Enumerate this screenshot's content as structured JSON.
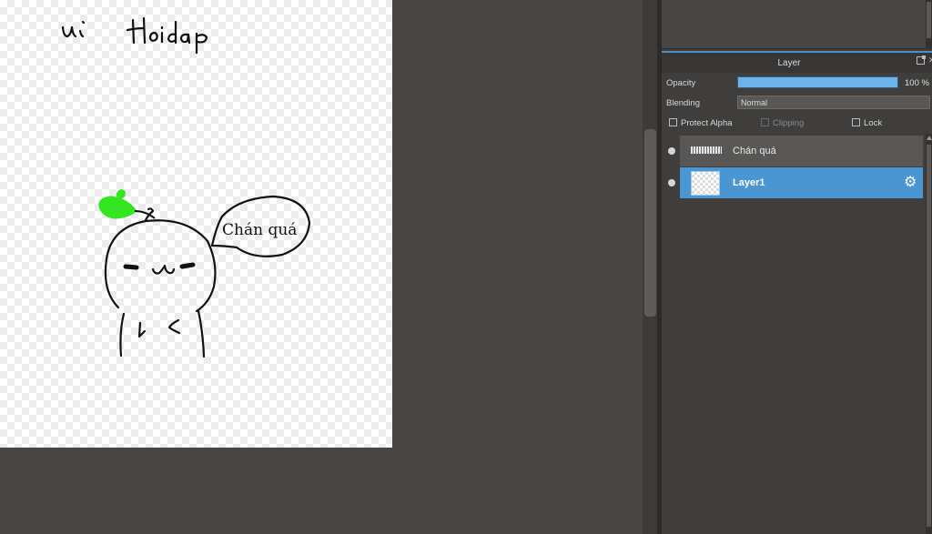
{
  "canvas": {
    "drawing": {
      "handwritten_title": "ui Hoidap",
      "speech_bubble_text": "Chán quá"
    }
  },
  "layer_panel": {
    "title": "Layer",
    "opacity": {
      "label": "Opacity",
      "value_text": "100 %",
      "value": 1.0
    },
    "blending": {
      "label": "Blending",
      "value": "Normal"
    },
    "options": {
      "protect_alpha": {
        "label": "Protect Alpha",
        "checked": false
      },
      "clipping": {
        "label": "Clipping",
        "checked": false,
        "disabled": true
      },
      "lock": {
        "label": "Lock",
        "checked": false
      }
    },
    "layers": [
      {
        "name": "Chán quá",
        "visible": true,
        "selected": false
      },
      {
        "name": "Layer1",
        "visible": true,
        "selected": true
      }
    ]
  },
  "colors": {
    "accent": "#4a96d3",
    "opacity_bar": "#6cb3ea",
    "sprout": "#33e61f"
  }
}
